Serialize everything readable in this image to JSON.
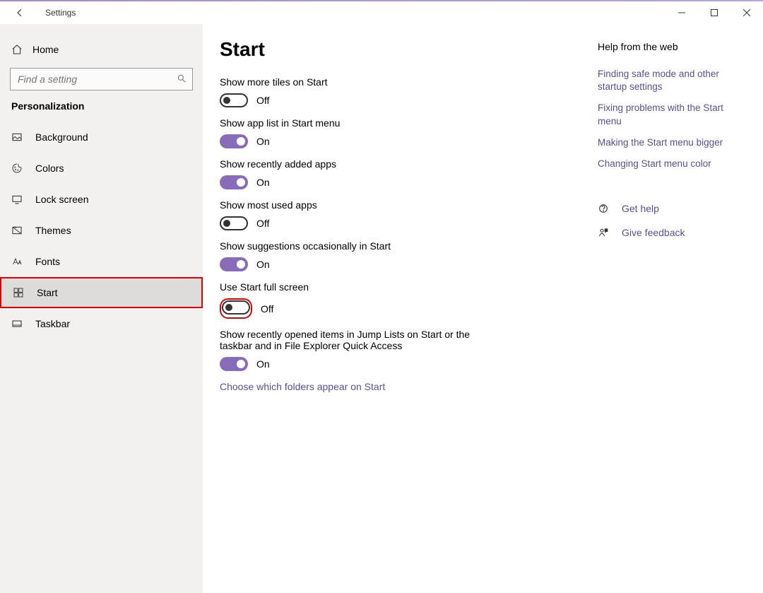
{
  "window": {
    "title": "Settings"
  },
  "sidebar": {
    "home_label": "Home",
    "search_placeholder": "Find a setting",
    "section": "Personalization",
    "items": [
      {
        "label": "Background"
      },
      {
        "label": "Colors"
      },
      {
        "label": "Lock screen"
      },
      {
        "label": "Themes"
      },
      {
        "label": "Fonts"
      },
      {
        "label": "Start"
      },
      {
        "label": "Taskbar"
      }
    ]
  },
  "page": {
    "title": "Start",
    "settings": [
      {
        "label": "Show more tiles on Start",
        "on": false,
        "state": "Off"
      },
      {
        "label": "Show app list in Start menu",
        "on": true,
        "state": "On"
      },
      {
        "label": "Show recently added apps",
        "on": true,
        "state": "On"
      },
      {
        "label": "Show most used apps",
        "on": false,
        "state": "Off"
      },
      {
        "label": "Show suggestions occasionally in Start",
        "on": true,
        "state": "On"
      },
      {
        "label": "Use Start full screen",
        "on": false,
        "state": "Off"
      },
      {
        "label": "Show recently opened items in Jump Lists on Start or the taskbar and in File Explorer Quick Access",
        "on": true,
        "state": "On"
      }
    ],
    "folders_link": "Choose which folders appear on Start"
  },
  "help": {
    "title": "Help from the web",
    "links": [
      "Finding safe mode and other startup settings",
      "Fixing problems with the Start menu",
      "Making the Start menu bigger",
      "Changing Start menu color"
    ],
    "actions": {
      "get_help": "Get help",
      "give_feedback": "Give feedback"
    }
  }
}
